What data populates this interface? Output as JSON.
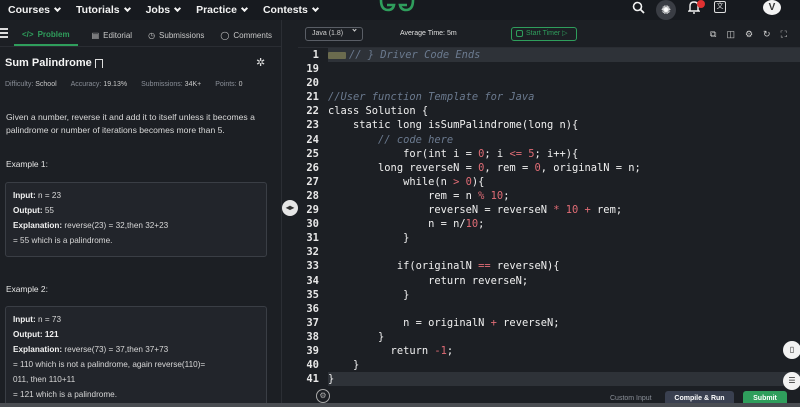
{
  "nav": {
    "items": [
      {
        "label": "Courses"
      },
      {
        "label": "Tutorials"
      },
      {
        "label": "Jobs"
      },
      {
        "label": "Practice"
      },
      {
        "label": "Contests"
      }
    ],
    "avatar_letter": "V",
    "translate_glyph": "文"
  },
  "tabs": [
    {
      "label": "Problem",
      "icon": "</>",
      "active": true
    },
    {
      "label": "Editorial",
      "icon": "▤"
    },
    {
      "label": "Submissions",
      "icon": "◷"
    },
    {
      "label": "Comments",
      "icon": "◯"
    }
  ],
  "problem": {
    "title": "Sum Palindrome",
    "difficulty_label": "Difficulty:",
    "difficulty": "School",
    "accuracy_label": "Accuracy:",
    "accuracy": "19.13%",
    "submissions_label": "Submissions:",
    "submissions": "34K+",
    "points_label": "Points:",
    "points": "0",
    "description": "Given a number, reverse it and add it to itself unless it becomes a palindrome or number of iterations becomes more than 5.",
    "examples": [
      {
        "title": "Example 1:",
        "input_label": "Input:",
        "input": "n = 23",
        "output_label": "Output:",
        "output": "55",
        "explanation_label": "Explanation:",
        "explanation_1": "reverse(23) = 32,then 32+23",
        "explanation_2": "= 55 which is a palindrome."
      },
      {
        "title": "Example 2:",
        "input_label": "Input:",
        "input": "n = 73",
        "output_label": "Output:",
        "output": "121",
        "explanation_label": "Explanation:",
        "explanation_1": "reverse(73) = 37,then 37+73",
        "explanation_2": "= 110 which is not a palindrome, again reverse(110)=",
        "explanation_3": "011, then 110+11",
        "explanation_4": "= 121 which is a palindrome."
      }
    ]
  },
  "editor": {
    "language": "Java (1.8)",
    "average_time": "Average Time: 5m",
    "start_timer": "Start Timer",
    "line_numbers": [
      "1",
      "19",
      "20",
      "21",
      "22",
      "23",
      "24",
      "25",
      "26",
      "27",
      "28",
      "29",
      "30",
      "31",
      "32",
      "33",
      "34",
      "35",
      "36",
      "37",
      "38",
      "39",
      "40",
      "41"
    ]
  },
  "bottom": {
    "custom_input": "Custom Input",
    "compile": "Compile & Run",
    "submit": "Submit"
  }
}
